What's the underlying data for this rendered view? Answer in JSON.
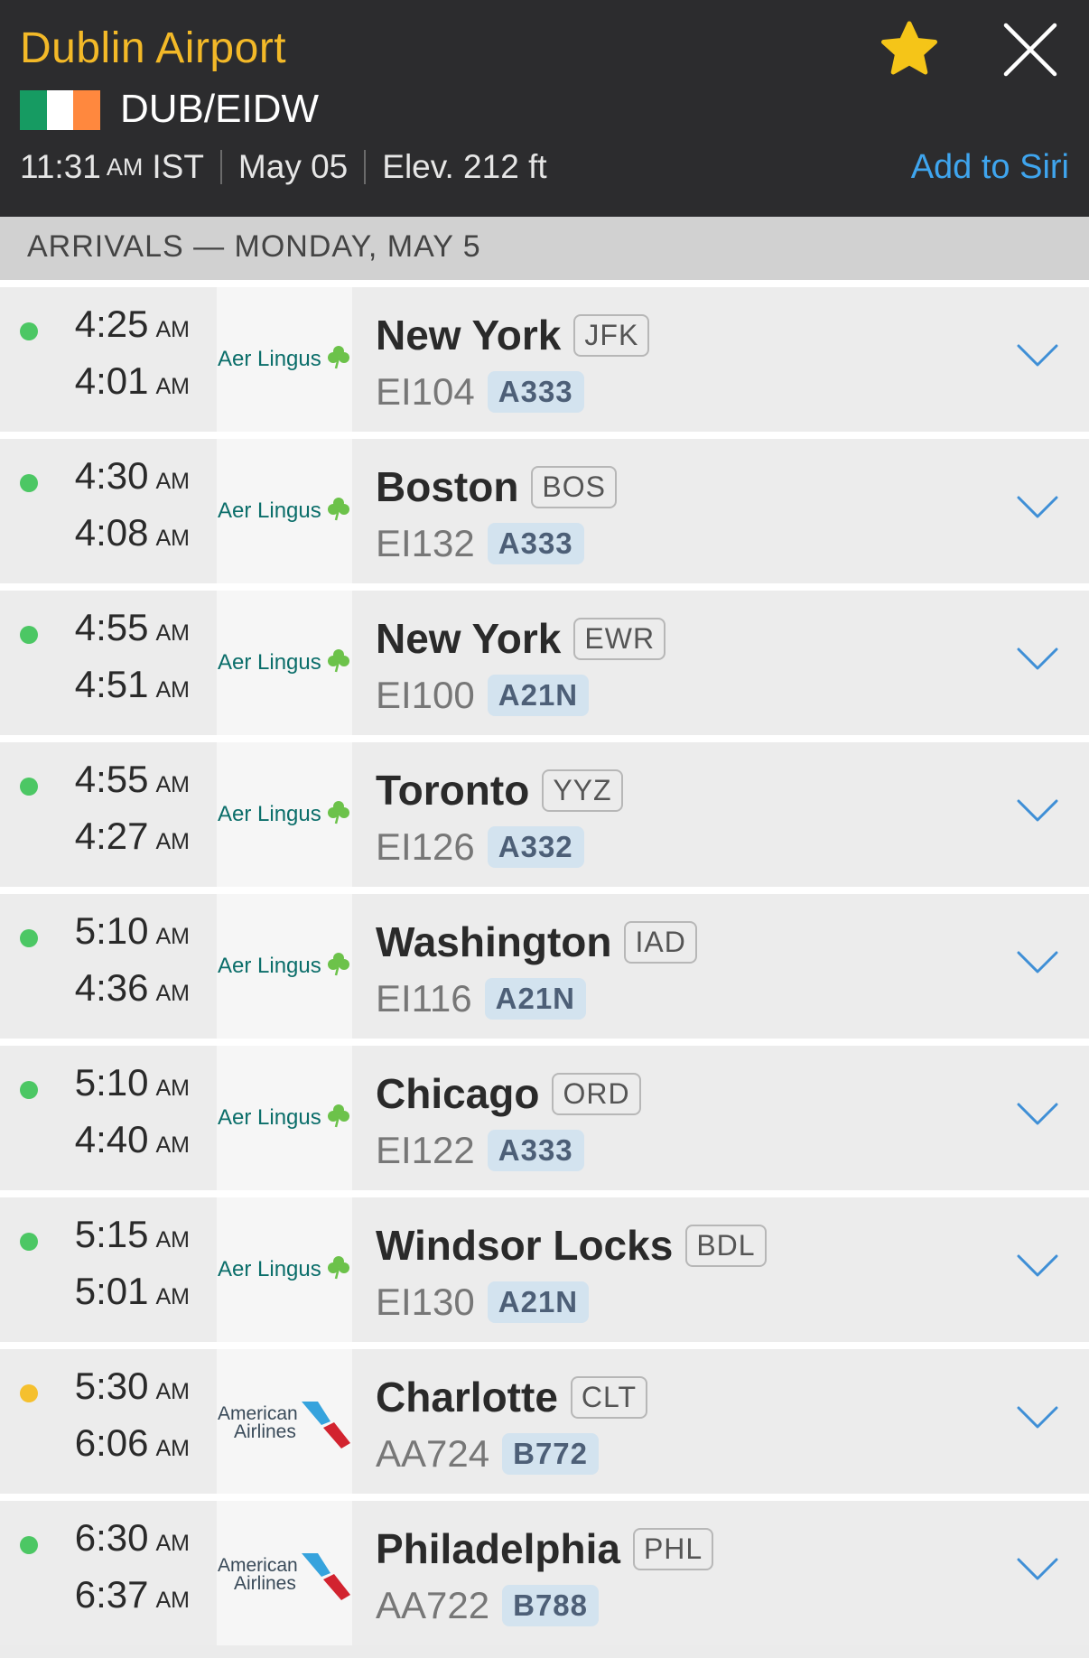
{
  "header": {
    "airport_name": "Dublin Airport",
    "codes": "DUB/EIDW",
    "time": "11:31",
    "time_ampm": "AM",
    "timezone": "IST",
    "date": "May 05",
    "elevation": "Elev. 212 ft",
    "add_to_siri": "Add to Siri",
    "flag_colors": [
      "#169b62",
      "#ffffff",
      "#ff883e"
    ],
    "accent_color": "#f3b928"
  },
  "section_title": "ARRIVALS — MONDAY, MAY 5",
  "flights": [
    {
      "status_color": "#4cc764",
      "sched": "4:25",
      "sched_ampm": "AM",
      "est": "4:01",
      "est_ampm": "AM",
      "airline": "Aer Lingus",
      "city": "New York",
      "iata": "JFK",
      "flight": "EI104",
      "aircraft": "A333"
    },
    {
      "status_color": "#4cc764",
      "sched": "4:30",
      "sched_ampm": "AM",
      "est": "4:08",
      "est_ampm": "AM",
      "airline": "Aer Lingus",
      "city": "Boston",
      "iata": "BOS",
      "flight": "EI132",
      "aircraft": "A333"
    },
    {
      "status_color": "#4cc764",
      "sched": "4:55",
      "sched_ampm": "AM",
      "est": "4:51",
      "est_ampm": "AM",
      "airline": "Aer Lingus",
      "city": "New York",
      "iata": "EWR",
      "flight": "EI100",
      "aircraft": "A21N"
    },
    {
      "status_color": "#4cc764",
      "sched": "4:55",
      "sched_ampm": "AM",
      "est": "4:27",
      "est_ampm": "AM",
      "airline": "Aer Lingus",
      "city": "Toronto",
      "iata": "YYZ",
      "flight": "EI126",
      "aircraft": "A332"
    },
    {
      "status_color": "#4cc764",
      "sched": "5:10",
      "sched_ampm": "AM",
      "est": "4:36",
      "est_ampm": "AM",
      "airline": "Aer Lingus",
      "city": "Washington",
      "iata": "IAD",
      "flight": "EI116",
      "aircraft": "A21N"
    },
    {
      "status_color": "#4cc764",
      "sched": "5:10",
      "sched_ampm": "AM",
      "est": "4:40",
      "est_ampm": "AM",
      "airline": "Aer Lingus",
      "city": "Chicago",
      "iata": "ORD",
      "flight": "EI122",
      "aircraft": "A333"
    },
    {
      "status_color": "#4cc764",
      "sched": "5:15",
      "sched_ampm": "AM",
      "est": "5:01",
      "est_ampm": "AM",
      "airline": "Aer Lingus",
      "city": "Windsor Locks",
      "iata": "BDL",
      "flight": "EI130",
      "aircraft": "A21N"
    },
    {
      "status_color": "#f5c02e",
      "sched": "5:30",
      "sched_ampm": "AM",
      "est": "6:06",
      "est_ampm": "AM",
      "airline": "American Airlines",
      "city": "Charlotte",
      "iata": "CLT",
      "flight": "AA724",
      "aircraft": "B772"
    },
    {
      "status_color": "#4cc764",
      "sched": "6:30",
      "sched_ampm": "AM",
      "est": "6:37",
      "est_ampm": "AM",
      "airline": "American Airlines",
      "city": "Philadelphia",
      "iata": "PHL",
      "flight": "AA722",
      "aircraft": "B788"
    }
  ]
}
